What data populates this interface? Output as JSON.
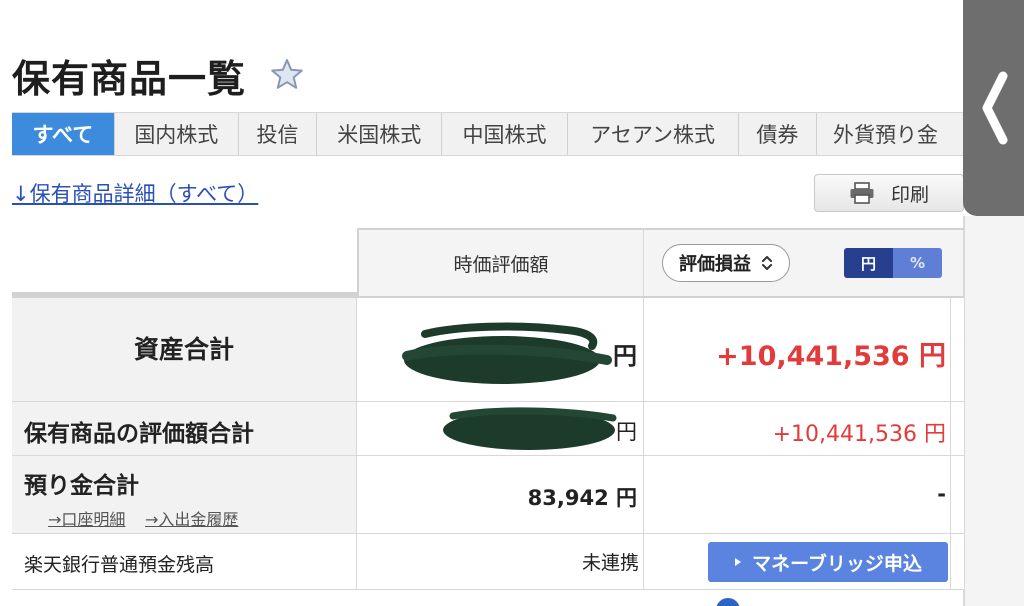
{
  "page": {
    "title": "保有商品一覧"
  },
  "tabs": [
    {
      "label": "すべて",
      "active": true
    },
    {
      "label": "国内株式"
    },
    {
      "label": "投信"
    },
    {
      "label": "米国株式"
    },
    {
      "label": "中国株式"
    },
    {
      "label": "アセアン株式"
    },
    {
      "label": "債券"
    },
    {
      "label": "外貨預り金"
    }
  ],
  "detail_link": "↓保有商品詳細（すべて）",
  "print_label": "印刷",
  "table": {
    "header_market_value": "時価評価額",
    "header_gain_select": "評価損益",
    "unit_yen": "円",
    "unit_percent": "%",
    "rows": {
      "total_assets": {
        "label": "資産合計",
        "value_unit": "円",
        "gain": "+10,441,536 円"
      },
      "holdings_total": {
        "label": "保有商品の評価額合計",
        "value_unit": "円",
        "gain": "+10,441,536 円"
      },
      "deposits": {
        "label": "預り金合計",
        "link_account": "→口座明細",
        "link_history": "→入出金履歴",
        "value": "83,942 円",
        "gain": "-"
      },
      "rakuten_bank": {
        "label": "楽天銀行普通預金残高",
        "status": "未連携",
        "button": "マネーブリッジ申込"
      }
    }
  },
  "colors": {
    "active_tab": "#3d8bdc",
    "gain_red": "#e23b3b",
    "link_blue": "#2a4fb8",
    "button_blue": "#5b84e0",
    "redaction_green": "#1c3b2a"
  }
}
